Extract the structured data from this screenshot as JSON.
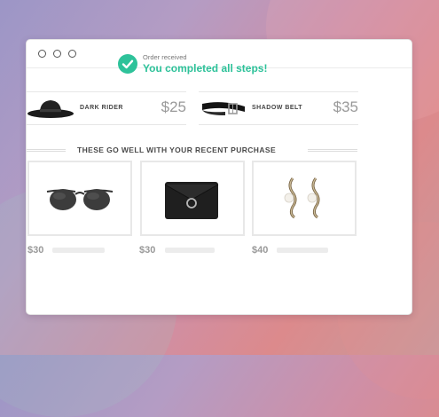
{
  "window": {
    "controls": [
      "window-dot",
      "window-dot",
      "window-dot"
    ]
  },
  "status": {
    "caption": "Order received",
    "headline": "You completed all steps!",
    "icon": "check-circle-icon",
    "accent_color": "#2ec29a"
  },
  "purchases": [
    {
      "name": "DARK RIDER",
      "price": "$25",
      "icon": "hat-image"
    },
    {
      "name": "SHADOW BELT",
      "price": "$35",
      "icon": "belt-image"
    }
  ],
  "recommendations": {
    "title": "THESE GO WELL WITH YOUR RECENT PURCHASE",
    "items": [
      {
        "price": "$30",
        "icon": "sunglasses-image"
      },
      {
        "price": "$30",
        "icon": "clutch-image"
      },
      {
        "price": "$40",
        "icon": "earrings-image"
      }
    ]
  }
}
